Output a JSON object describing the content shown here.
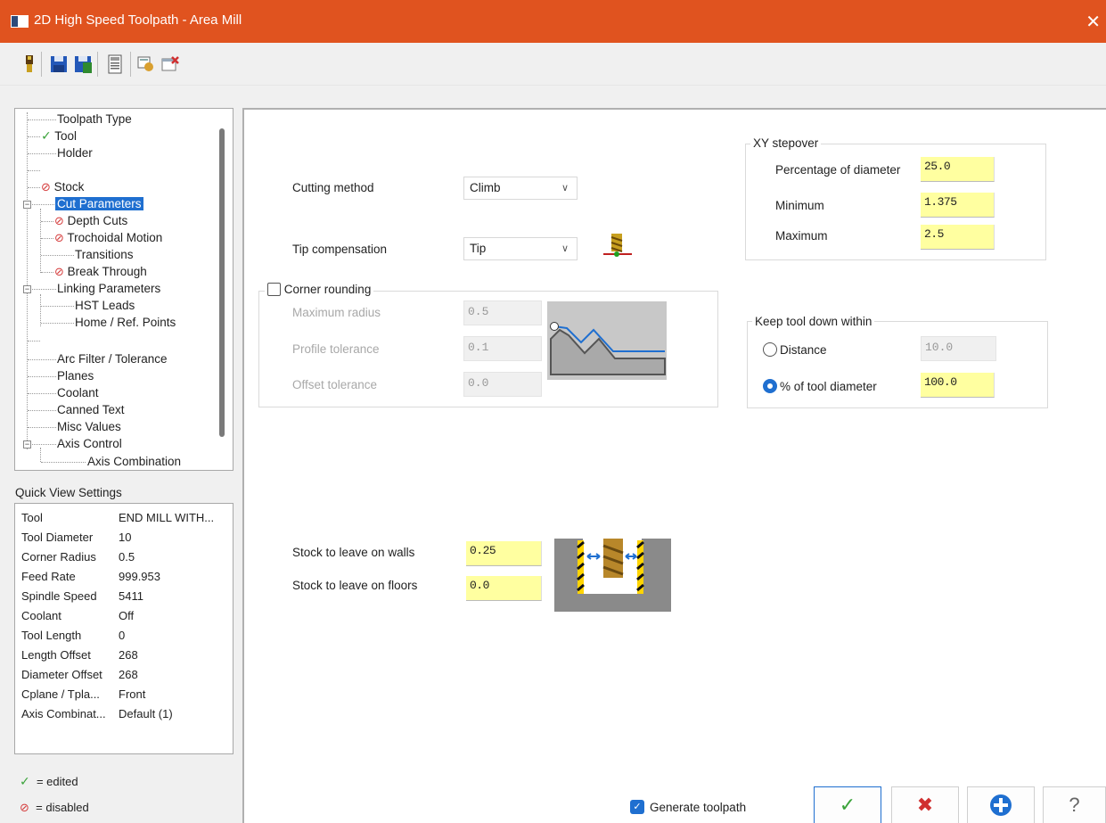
{
  "window": {
    "title": "2D High Speed Toolpath - Area Mill",
    "close_glyph": "✕"
  },
  "toolbar": {
    "icons": [
      "tool-icon",
      "save-icon",
      "save-as-icon",
      "calculator-icon",
      "view-icon",
      "close-dialog-icon"
    ]
  },
  "tree": {
    "items": [
      {
        "label": "Toolpath Type",
        "status": ""
      },
      {
        "label": "Tool",
        "status": "edited"
      },
      {
        "label": "Holder",
        "status": ""
      },
      {
        "label": "",
        "status": ""
      },
      {
        "label": "Stock",
        "status": "disabled"
      },
      {
        "label": "Cut Parameters",
        "status": "selected"
      },
      {
        "label": "Depth Cuts",
        "status": "disabled"
      },
      {
        "label": "Trochoidal Motion",
        "status": "disabled"
      },
      {
        "label": "Transitions",
        "status": ""
      },
      {
        "label": "Break Through",
        "status": "disabled"
      },
      {
        "label": "Linking Parameters",
        "status": ""
      },
      {
        "label": "HST Leads",
        "status": ""
      },
      {
        "label": "Home / Ref. Points",
        "status": ""
      },
      {
        "label": "",
        "status": ""
      },
      {
        "label": "Arc Filter / Tolerance",
        "status": ""
      },
      {
        "label": "Planes",
        "status": ""
      },
      {
        "label": "Coolant",
        "status": ""
      },
      {
        "label": "Canned Text",
        "status": ""
      },
      {
        "label": "Misc Values",
        "status": ""
      },
      {
        "label": "Axis Control",
        "status": ""
      },
      {
        "label": "Axis Combination",
        "status": ""
      }
    ]
  },
  "quick_view": {
    "title": "Quick View Settings",
    "rows": [
      {
        "k": "Tool",
        "v": "END MILL WITH..."
      },
      {
        "k": "Tool Diameter",
        "v": "10"
      },
      {
        "k": "Corner Radius",
        "v": "0.5"
      },
      {
        "k": "Feed Rate",
        "v": "999.953"
      },
      {
        "k": "Spindle Speed",
        "v": "5411"
      },
      {
        "k": "Coolant",
        "v": "Off"
      },
      {
        "k": "Tool Length",
        "v": "0"
      },
      {
        "k": "Length Offset",
        "v": "268"
      },
      {
        "k": "Diameter Offset",
        "v": "268"
      },
      {
        "k": "Cplane / Tpla...",
        "v": "Front"
      },
      {
        "k": "Axis Combinat...",
        "v": "Default (1)"
      }
    ]
  },
  "legend": {
    "edited": "= edited",
    "disabled": "= disabled"
  },
  "cut": {
    "cutting_method_label": "Cutting method",
    "cutting_method_value": "Climb",
    "tip_comp_label": "Tip compensation",
    "tip_comp_value": "Tip"
  },
  "corner_rounding": {
    "title": "Corner rounding",
    "checked": false,
    "max_radius_label": "Maximum radius",
    "max_radius": "0.5",
    "profile_tol_label": "Profile tolerance",
    "profile_tol": "0.1",
    "offset_tol_label": "Offset tolerance",
    "offset_tol": "0.0"
  },
  "xy_stepover": {
    "title": "XY stepover",
    "pct_label": "Percentage of diameter",
    "pct": "25.0",
    "min_label": "Minimum",
    "min": "1.375",
    "max_label": "Maximum",
    "max": "2.5"
  },
  "keep_down": {
    "title": "Keep tool down within",
    "distance_label": "Distance",
    "distance": "10.0",
    "pct_label": "% of tool diameter",
    "pct": "100.0",
    "selected": "pct"
  },
  "stock": {
    "walls_label": "Stock to leave on walls",
    "walls": "0.25",
    "floors_label": "Stock to leave on floors",
    "floors": "0.0"
  },
  "footer": {
    "generate_label": "Generate toolpath",
    "generate_checked": true,
    "buttons": [
      "ok-icon",
      "cancel-icon",
      "apply-icon",
      "help-icon"
    ]
  },
  "colors": {
    "title_bar": "#e0531f",
    "selection": "#1f6fd0",
    "input_highlight": "#ffffa0"
  }
}
